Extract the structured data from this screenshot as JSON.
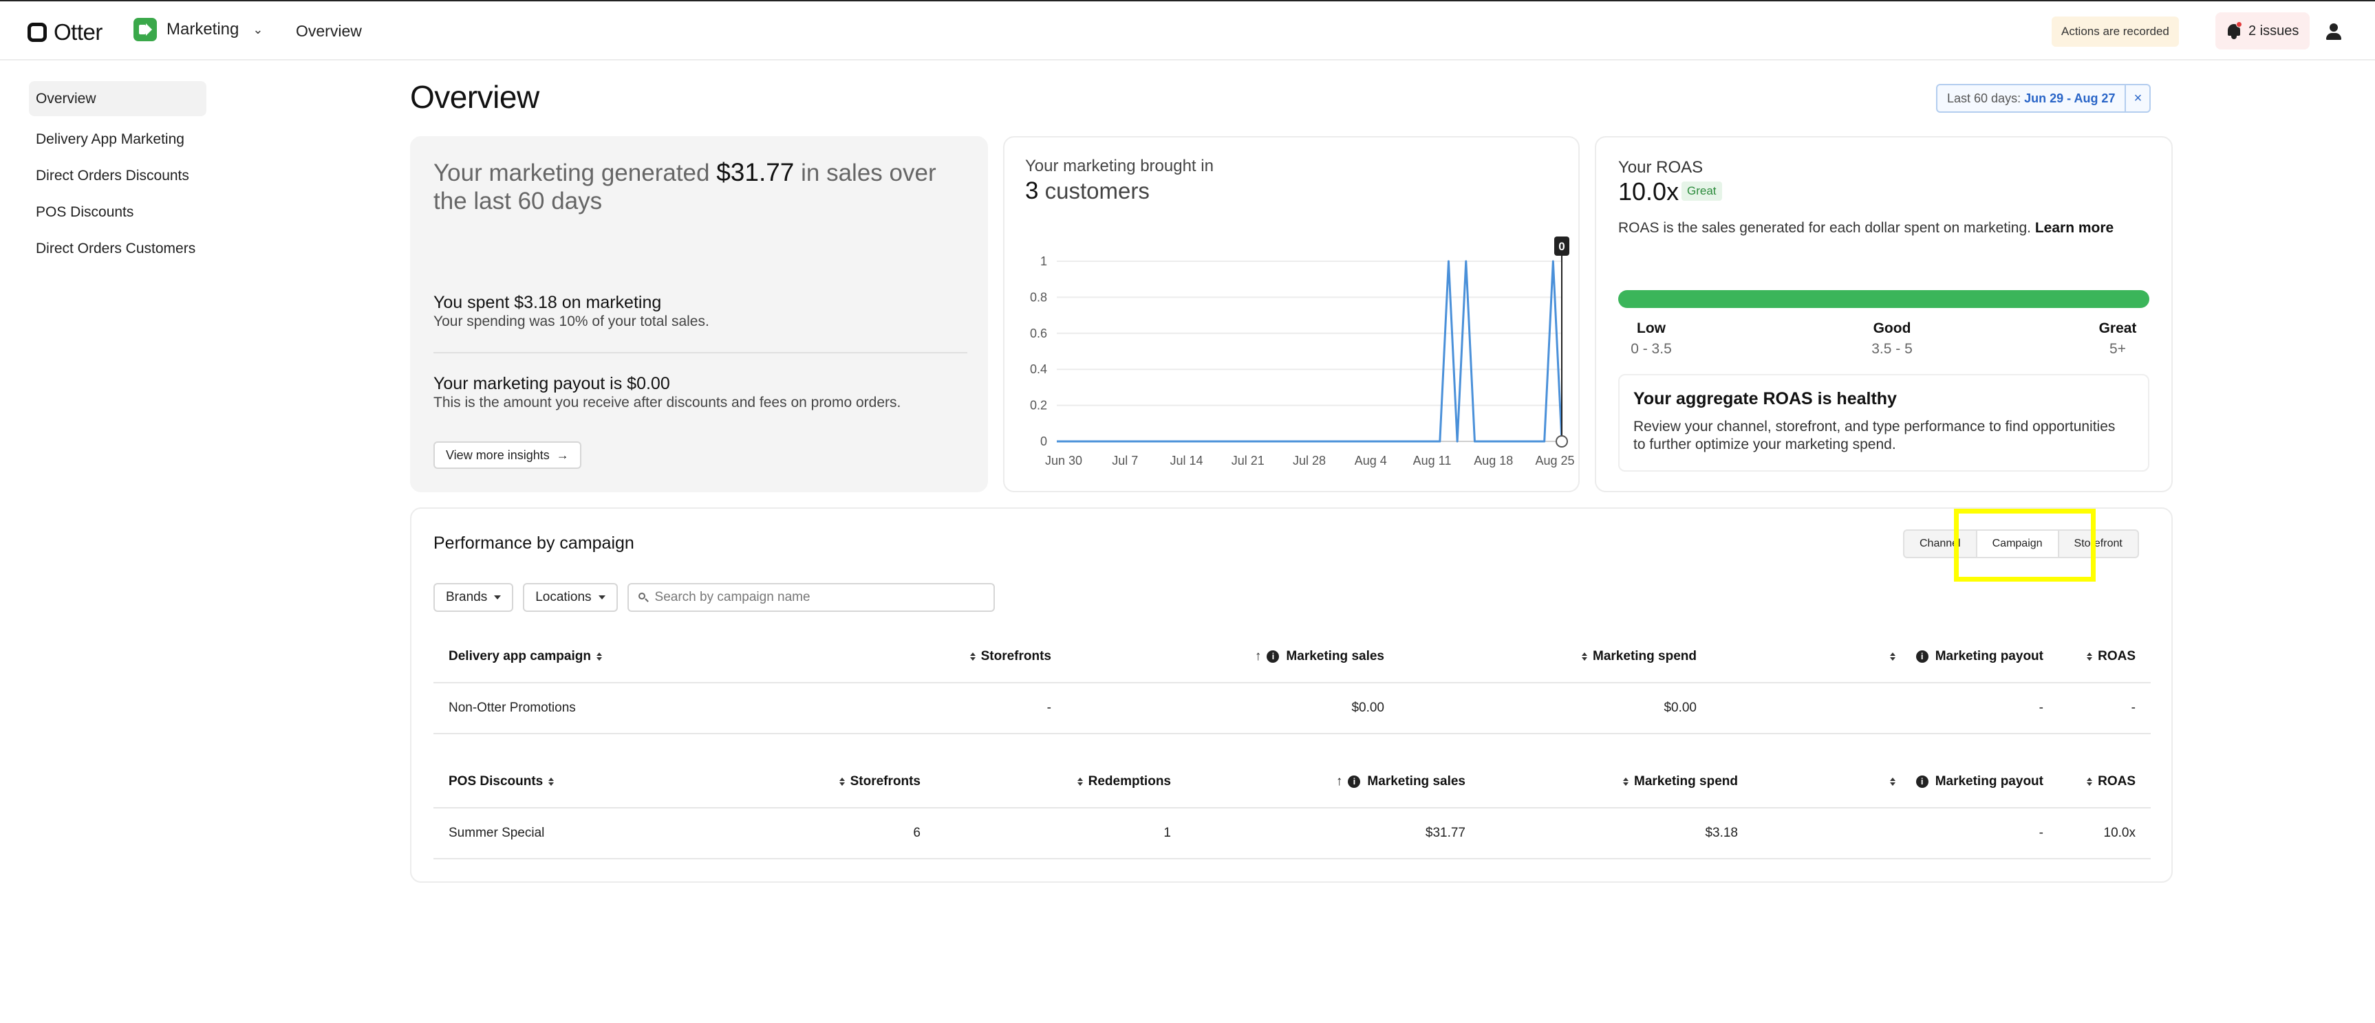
{
  "topbar": {
    "logo_text": "Otter",
    "app_name": "Marketing",
    "nav_overview": "Overview",
    "recorded_badge": "Actions are recorded",
    "issues_label": "2 issues"
  },
  "sidebar": {
    "items": [
      {
        "label": "Overview",
        "active": true
      },
      {
        "label": "Delivery App Marketing"
      },
      {
        "label": "Direct Orders Discounts"
      },
      {
        "label": "POS Discounts"
      },
      {
        "label": "Direct Orders Customers"
      }
    ]
  },
  "page": {
    "title": "Overview",
    "date_range_prefix": "Last 60 days:",
    "date_range_value": "Jun 29 - Aug 27",
    "date_close": "×"
  },
  "summary": {
    "headline_pre": "Your marketing generated",
    "headline_amount": "$31.77",
    "headline_post": "in sales over the last 60 days",
    "spent_title": "You spent $3.18 on marketing",
    "spent_sub": "Your spending was 10% of your total sales.",
    "payout_title": "Your marketing payout is $0.00",
    "payout_sub": "This is the amount you receive after discounts and fees on promo orders.",
    "insights_button": "View more insights",
    "insights_arrow": "→"
  },
  "customers": {
    "label": "Your marketing brought in",
    "count": "3",
    "unit": "customers"
  },
  "chart_data": {
    "type": "line",
    "x_tick_labels": [
      "Jun 30",
      "Jul 7",
      "Jul 14",
      "Jul 21",
      "Jul 28",
      "Aug 4",
      "Aug 11",
      "Aug 18",
      "Aug 25"
    ],
    "y_tick_labels": [
      "0",
      "0.2",
      "0.4",
      "0.6",
      "0.8",
      "1"
    ],
    "ylim": [
      0,
      1
    ],
    "xlim": [
      0,
      58
    ],
    "series": [
      {
        "x": [
          0,
          44,
          45,
          46,
          47,
          48,
          56,
          57,
          58
        ],
        "values": [
          0,
          0,
          1,
          0,
          1,
          0,
          0,
          1,
          0
        ]
      }
    ],
    "tooltip_value": "0",
    "line_color": "#4a90d9",
    "grid": true
  },
  "roas": {
    "label": "Your ROAS",
    "value": "10.0x",
    "badge": "Great",
    "desc": "ROAS is the sales generated for each dollar spent on marketing.",
    "learn_more": "Learn more",
    "bar_color": "#3bb55a",
    "tiers": [
      {
        "title": "Low",
        "range": "0 - 3.5"
      },
      {
        "title": "Good",
        "range": "3.5 - 5"
      },
      {
        "title": "Great",
        "range": "5+"
      }
    ],
    "health_title": "Your aggregate ROAS is healthy",
    "health_sub": "Review your channel, storefront, and type performance to find opportunities to further optimize your marketing spend."
  },
  "performance": {
    "title": "Performance by campaign",
    "segments": [
      "Channel",
      "Campaign",
      "Storefront"
    ],
    "active_segment": "Campaign",
    "filters": {
      "brands": "Brands",
      "locations": "Locations",
      "search_placeholder": "Search by campaign name"
    },
    "delivery_table": {
      "headers": [
        "Delivery app campaign",
        "Storefronts",
        "Marketing sales",
        "Marketing spend",
        "Marketing payout",
        "ROAS"
      ],
      "rows": [
        [
          "Non-Otter Promotions",
          "-",
          "$0.00",
          "$0.00",
          "-",
          "-"
        ]
      ]
    },
    "pos_table": {
      "headers": [
        "POS Discounts",
        "Storefronts",
        "Redemptions",
        "Marketing sales",
        "Marketing spend",
        "Marketing payout",
        "ROAS"
      ],
      "rows": [
        [
          "Summer Special",
          "6",
          "1",
          "$31.77",
          "$3.18",
          "-",
          "10.0x"
        ]
      ]
    }
  }
}
